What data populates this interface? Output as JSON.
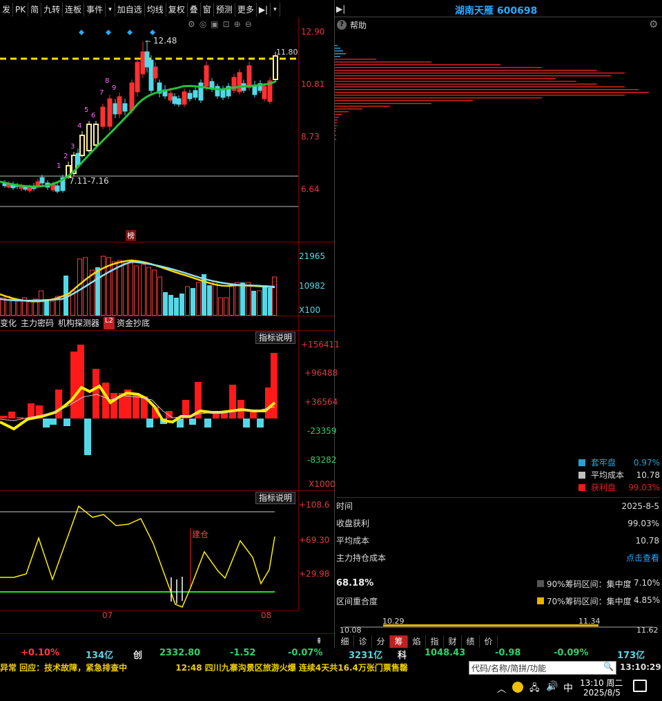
{
  "toolbar": {
    "items": [
      "发",
      "PK",
      "简",
      "九转",
      "连板",
      "事件",
      "▾",
      "加自选",
      "均线",
      "复权",
      "叠",
      "窗",
      "预测",
      "更多",
      "▶|",
      "▾"
    ]
  },
  "header": {
    "stock_title": "湖南天雁 600698",
    "help_label": "帮助",
    "expand_icon": "expand-icon"
  },
  "price_chart": {
    "axis_labels": [
      "12.90",
      "10.81",
      "8.73",
      "6.64"
    ],
    "dashed_level": "11.80",
    "high_label": "12.48",
    "range_label": "7.11-7.16",
    "counter_labels": [
      "1",
      "2",
      "3",
      "4",
      "5",
      "6",
      "7",
      "8",
      "9"
    ],
    "bang_badge": "榜",
    "accent_up": "#ff3030",
    "accent_down": "#52d9e8",
    "ma_color": "#22c53a",
    "dash_color": "#ffe000"
  },
  "volume_chart": {
    "axis_labels": [
      "21965",
      "10982",
      "X100"
    ]
  },
  "indicator_tabs": [
    "变化",
    "主力密码",
    "机构探测器",
    "L2",
    "资金抄底"
  ],
  "fund_chart": {
    "help_button": "指标说明",
    "axis_labels": [
      "+156411",
      "+96488",
      "+36564",
      "-23359",
      "-83282",
      "X1000"
    ]
  },
  "osc_chart": {
    "help_button": "指标说明",
    "axis_labels": [
      "+108.6",
      "+69.30",
      "+29.98"
    ],
    "build_label": "建仓",
    "x_labels": [
      "07",
      "08"
    ]
  },
  "chip_panel": {
    "legend": [
      {
        "label": "套牢盘",
        "value": "0.97%",
        "color": "#2aa0d0"
      },
      {
        "label": "平均成本",
        "value": "10.78",
        "color": "#c0c0c0"
      },
      {
        "label": "获利盘",
        "value": "99.03%",
        "color": "#e02020"
      }
    ],
    "rows": [
      {
        "k": "时间",
        "v": "2025-8-5"
      },
      {
        "k": "收盘获利",
        "v": "99.03%"
      },
      {
        "k": "平均成本",
        "v": "10.78"
      },
      {
        "k": "主力持仓成本",
        "v": "点击查看"
      }
    ],
    "concentration_pct": "68.18%",
    "overlap_label": "区间重合度",
    "range90": "90%筹码区间：集中度",
    "range90_val": "7.10%",
    "range70": "70%筹码区间：集中度",
    "range70_val": "4.85%",
    "bar_labels": {
      "low_top": "10.29",
      "high_top": "11.34",
      "low_bot": "10.08",
      "high_bot": "11.62"
    }
  },
  "bottom_tabs": [
    "细",
    "诊",
    "分",
    "筹",
    "焰",
    "指",
    "财",
    "绩",
    "价"
  ],
  "status_bar": {
    "items": [
      {
        "t": "+0.10%",
        "c": "#ff3b3b"
      },
      {
        "t": "134亿",
        "c": "#52d9e8"
      },
      {
        "t": "创",
        "c": "#e8e8e8"
      },
      {
        "t": "2332.80",
        "c": "#33d06a"
      },
      {
        "t": "-1.52",
        "c": "#33d06a"
      },
      {
        "t": "-0.07%",
        "c": "#33d06a"
      },
      {
        "t": "3231亿",
        "c": "#52d9e8"
      },
      {
        "t": "科",
        "c": "#e8e8e8"
      },
      {
        "t": "1048.43",
        "c": "#33d06a"
      },
      {
        "t": "-0.98",
        "c": "#33d06a"
      },
      {
        "t": "-0.09%",
        "c": "#33d06a"
      },
      {
        "t": "173亿",
        "c": "#52d9e8"
      }
    ]
  },
  "news": {
    "text1": "异常 回应：技术故障，紧急排查中",
    "text2": "12:48 四川九寨沟景区旅游火爆 连续4天共16.4万张门票售罄"
  },
  "search": {
    "placeholder": "代码/名称/简拼/功能",
    "clock": "13:10:29"
  },
  "taskbar": {
    "ime": "中",
    "time": "13:10 周二",
    "date": "2025/8/5"
  }
}
